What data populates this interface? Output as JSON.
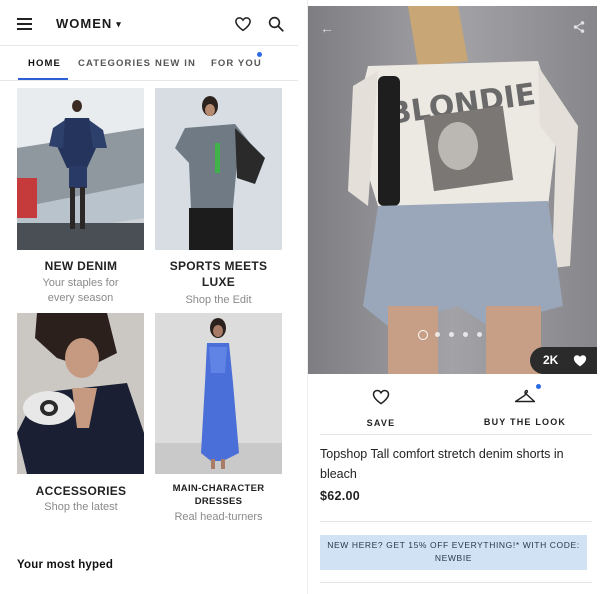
{
  "left": {
    "store_label": "WOMEN",
    "tabs": [
      {
        "label": "HOME"
      },
      {
        "label": "CATEGORIES"
      },
      {
        "label": "NEW IN"
      },
      {
        "label": "FOR YOU"
      }
    ],
    "tiles": [
      {
        "title": "NEW DENIM",
        "subtitle": "Your staples for every season"
      },
      {
        "title": "SPORTS MEETS LUXE",
        "subtitle": "Shop the Edit"
      },
      {
        "title": "ACCESSORIES",
        "subtitle": "Shop the latest"
      },
      {
        "title": "MAIN-CHARACTER DRESSES",
        "subtitle": "Real head-turners"
      }
    ],
    "section_heading": "Your most hyped"
  },
  "right": {
    "likes_count": "2K",
    "carousel": {
      "total": 5,
      "active": 1
    },
    "actions": {
      "save_label": "SAVE",
      "buy_look_label": "BUY THE LOOK"
    },
    "product": {
      "title": "Topshop Tall comfort stretch denim shorts in bleach",
      "price": "$62.00"
    },
    "promo_text": "NEW HERE? GET 15% OFF EVERYTHING!* WITH CODE: NEWBIE"
  },
  "icons": {
    "menu": "hamburger-icon",
    "wishlist": "heart-icon",
    "search": "search-icon",
    "share": "share-icon",
    "back": "arrow-left-icon",
    "hanger": "hanger-icon"
  },
  "colors": {
    "accent": "#2d5fd6",
    "notification_dot": "#2d6be0",
    "promo_bg": "#d2e2f5",
    "likes_pill": "#2b2b2b"
  }
}
